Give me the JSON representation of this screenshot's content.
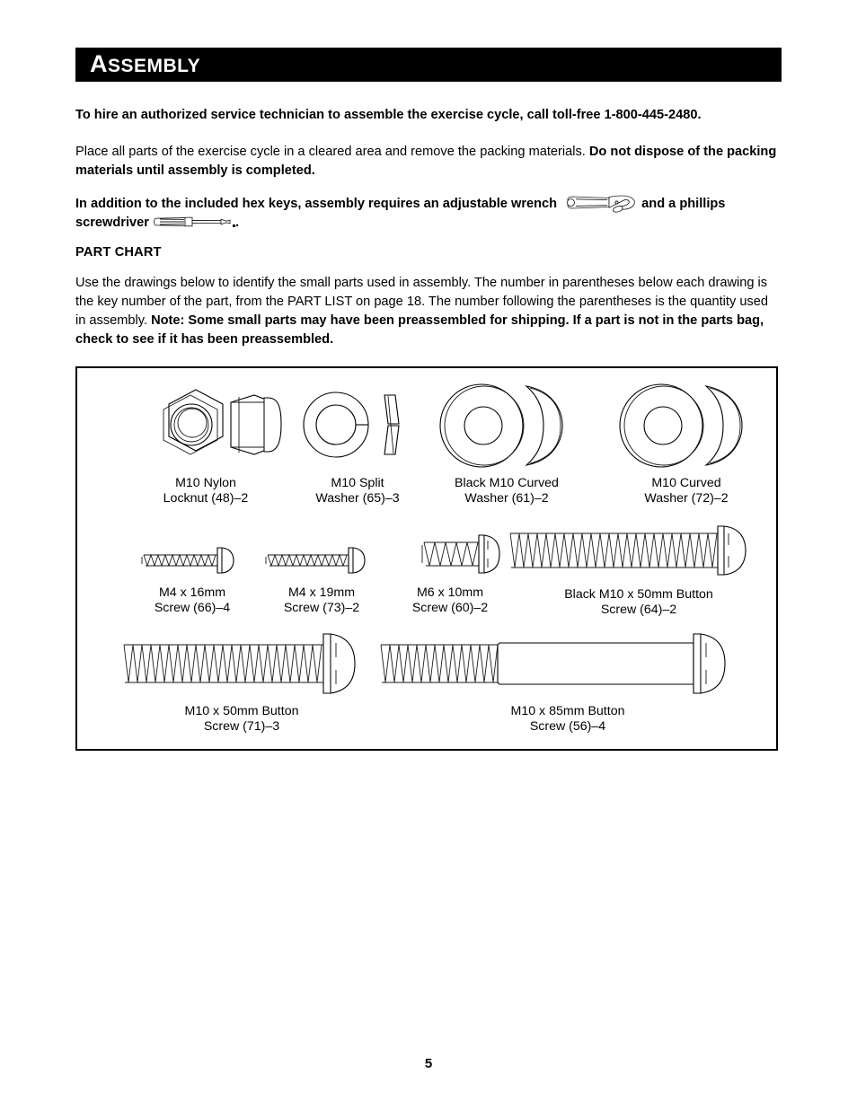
{
  "document": {
    "page_number": "5",
    "section_title_first_letter": "A",
    "section_title_rest": "SSEMBLY"
  },
  "paragraphs": {
    "hire_technician": "To hire an authorized service technician to assemble the exercise cycle, call toll-free 1-800-445-2480.",
    "place_parts_normal": "Place all parts of the exercise cycle in a cleared area and remove the packing materials. ",
    "place_parts_bold": "Do not dispose of the packing materials until assembly is completed.",
    "tools_before_wrench": "In addition to the included hex keys, assembly requires an adjustable wrench ",
    "tools_after_wrench": " and a phillips screwdriver ",
    "tools_end": ".",
    "part_chart_heading": "PART CHART",
    "use_drawings_normal": "Use the drawings below to identify the small parts used in assembly. The number in parentheses below each drawing is the key number of the part, from the PART LIST on page 18. The number following the parentheses is the quantity used in assembly. ",
    "use_drawings_bold": "Note: Some small parts may have been preassembled for shipping. If a part is not in the parts bag, check to see if it has been preassembled."
  },
  "icons": {
    "wrench": "adjustable-wrench-icon",
    "screwdriver": "phillips-screwdriver-icon"
  },
  "part_chart": {
    "row1": [
      {
        "name": "m10-nylon-locknut",
        "line1": "M10 Nylon",
        "line2": "Locknut (48)–2",
        "key": "48",
        "qty": "2"
      },
      {
        "name": "m10-split-washer",
        "line1": "M10 Split",
        "line2": "Washer (65)–3",
        "key": "65",
        "qty": "3"
      },
      {
        "name": "black-m10-curved-washer",
        "line1": "Black M10 Curved",
        "line2": "Washer (61)–2",
        "key": "61",
        "qty": "2"
      },
      {
        "name": "m10-curved-washer",
        "line1": "M10 Curved",
        "line2": "Washer (72)–2",
        "key": "72",
        "qty": "2"
      }
    ],
    "row2": [
      {
        "name": "m4-x-16mm-screw",
        "line1": "M4 x 16mm",
        "line2": "Screw (66)–4",
        "key": "66",
        "qty": "4"
      },
      {
        "name": "m4-x-19mm-screw",
        "line1": "M4 x 19mm",
        "line2": "Screw (73)–2",
        "key": "73",
        "qty": "2"
      },
      {
        "name": "m6-x-10mm-screw",
        "line1": "M6 x 10mm",
        "line2": "Screw (60)–2",
        "key": "60",
        "qty": "2"
      },
      {
        "name": "black-m10-x-50mm-button-screw",
        "line1": "Black M10 x 50mm Button",
        "line2": "Screw (64)–2",
        "key": "64",
        "qty": "2"
      }
    ],
    "row3": [
      {
        "name": "m10-x-50mm-button-screw",
        "line1": "M10 x 50mm Button",
        "line2": "Screw (71)–3",
        "key": "71",
        "qty": "3"
      },
      {
        "name": "m10-x-85mm-button-screw",
        "line1": "M10 x 85mm Button",
        "line2": "Screw (56)–4",
        "key": "56",
        "qty": "4"
      }
    ]
  },
  "colors": {
    "title_bar_background": "#000000",
    "title_text": "#ffffff",
    "body_text": "#000000",
    "chart_border": "#000000",
    "page_background": "#ffffff"
  }
}
